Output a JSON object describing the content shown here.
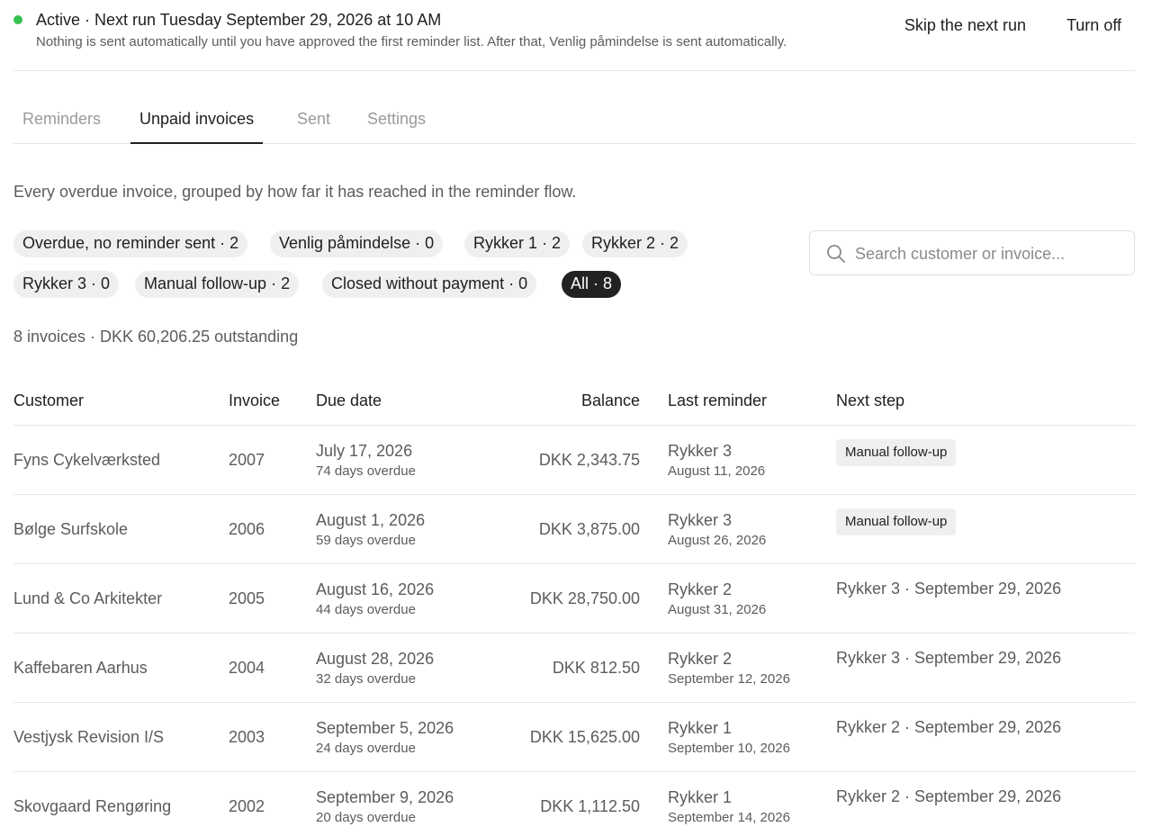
{
  "status": {
    "title": "Active · Next run Tuesday September 29, 2026 at 10 AM",
    "subtitle": "Nothing is sent automatically until you have approved the first reminder list. After that, Venlig påmindelse is sent automatically.",
    "skip_label": "Skip the next run",
    "off_label": "Turn off",
    "dot_color": "#35c24f"
  },
  "tabs": [
    {
      "label": "Reminders",
      "active": false
    },
    {
      "label": "Unpaid invoices",
      "active": true
    },
    {
      "label": "Sent",
      "active": false
    },
    {
      "label": "Settings",
      "active": false
    }
  ],
  "intro": "Every overdue invoice, grouped by how far it has reached in the reminder flow.",
  "filters": [
    {
      "label": "Overdue, no reminder sent · 2",
      "active": false
    },
    {
      "label": "Venlig påmindelse · 0",
      "active": false
    },
    {
      "label": "Rykker 1 · 2",
      "active": false
    },
    {
      "label": "Rykker 2 · 2",
      "active": false
    },
    {
      "label": "Rykker 3 · 0",
      "active": false
    },
    {
      "label": "Manual follow-up · 2",
      "active": false
    },
    {
      "label": "Closed without payment · 0",
      "active": false
    },
    {
      "label": "All · 8",
      "active": true
    }
  ],
  "search": {
    "placeholder": "Search customer or invoice...",
    "value": "",
    "icon": "search-icon"
  },
  "summary": "8 invoices · DKK 60,206.25 outstanding",
  "table": {
    "columns": [
      "Customer",
      "Invoice",
      "Due date",
      "Balance",
      "Last reminder",
      "Next step"
    ],
    "rows": [
      {
        "customer": "Fyns Cykelværksted",
        "invoice": "2007",
        "due": "July 17, 2026",
        "overdue": "74 days overdue",
        "balance": "DKK 2,343.75",
        "last": "Rykker 3",
        "last_date": "August 11, 2026",
        "next": "Manual follow-up",
        "next_badge": true
      },
      {
        "customer": "Bølge Surfskole",
        "invoice": "2006",
        "due": "August 1, 2026",
        "overdue": "59 days overdue",
        "balance": "DKK 3,875.00",
        "last": "Rykker 3",
        "last_date": "August 26, 2026",
        "next": "Manual follow-up",
        "next_badge": true
      },
      {
        "customer": "Lund & Co Arkitekter",
        "invoice": "2005",
        "due": "August 16, 2026",
        "overdue": "44 days overdue",
        "balance": "DKK 28,750.00",
        "last": "Rykker 2",
        "last_date": "August 31, 2026",
        "next": "Rykker 3 · September 29, 2026",
        "next_badge": false
      },
      {
        "customer": "Kaffebaren Aarhus",
        "invoice": "2004",
        "due": "August 28, 2026",
        "overdue": "32 days overdue",
        "balance": "DKK 812.50",
        "last": "Rykker 2",
        "last_date": "September 12, 2026",
        "next": "Rykker 3 · September 29, 2026",
        "next_badge": false
      },
      {
        "customer": "Vestjysk Revision I/S",
        "invoice": "2003",
        "due": "September 5, 2026",
        "overdue": "24 days overdue",
        "balance": "DKK 15,625.00",
        "last": "Rykker 1",
        "last_date": "September 10, 2026",
        "next": "Rykker 2 · September 29, 2026",
        "next_badge": false
      },
      {
        "customer": "Skovgaard Rengøring",
        "invoice": "2002",
        "due": "September 9, 2026",
        "overdue": "20 days overdue",
        "balance": "DKK 1,112.50",
        "last": "Rykker 1",
        "last_date": "September 14, 2026",
        "next": "Rykker 2 · September 29, 2026",
        "next_badge": false
      }
    ]
  }
}
